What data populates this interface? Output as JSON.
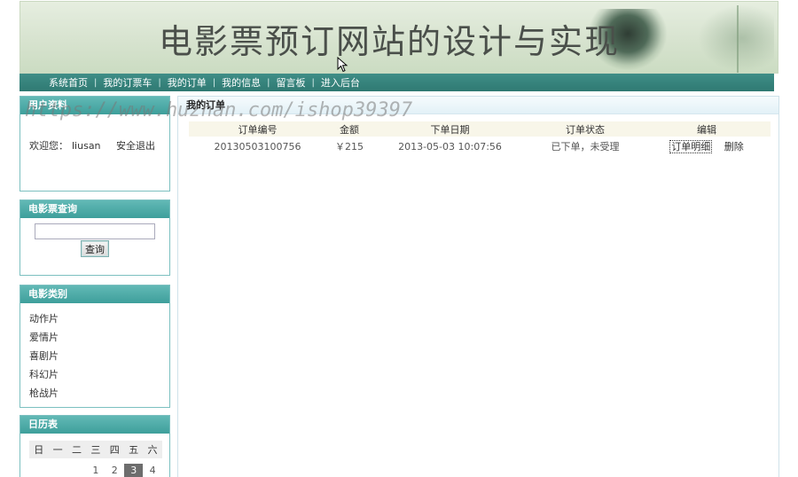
{
  "banner": {
    "title": "电影票预订网站的设计与实现"
  },
  "nav": {
    "items": [
      "系统首页",
      "我的订票车",
      "我的订单",
      "我的信息",
      "留言板",
      "进入后台"
    ],
    "separator": "|"
  },
  "sidebar": {
    "user_box": {
      "title": "用户资料",
      "welcome": "欢迎您：",
      "username": "liusan",
      "logout": "安全退出"
    },
    "search_box": {
      "title": "电影票查询",
      "input_value": "",
      "button_label": "查询"
    },
    "category_box": {
      "title": "电影类别",
      "items": [
        "动作片",
        "爱情片",
        "喜剧片",
        "科幻片",
        "枪战片"
      ]
    },
    "calendar_box": {
      "title": "日历表",
      "weekdays": [
        "日",
        "一",
        "二",
        "三",
        "四",
        "五",
        "六"
      ],
      "first_row": [
        "1",
        "2",
        "3",
        "4"
      ],
      "today": "3"
    }
  },
  "main": {
    "title": "我的订单",
    "columns": [
      "订单编号",
      "金额",
      "下单日期",
      "订单状态",
      "编辑"
    ],
    "rows": [
      {
        "order_no": "20130503100756",
        "amount": "￥215",
        "date": "2013-05-03 10:07:56",
        "status": "已下单，未受理",
        "detail_label": "订单明细",
        "delete_label": "删除"
      }
    ]
  },
  "watermark": "https://www.huzhan.com/ishop39397",
  "colors": {
    "nav_bg": "#3f8e87",
    "box_head": "#4eaba8",
    "box_border": "#7cc0c0"
  }
}
